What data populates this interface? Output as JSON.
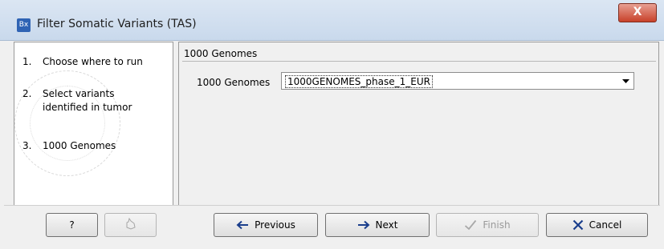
{
  "window": {
    "app_icon_text": "Bx",
    "title": "Filter Somatic Variants (TAS)",
    "close_glyph": "X"
  },
  "steps": [
    {
      "number": "1.",
      "label": "Choose where to run"
    },
    {
      "number": "2.",
      "label": "Select variants identified in tumor"
    },
    {
      "number": "3.",
      "label": "1000 Genomes"
    }
  ],
  "section": {
    "title": "1000 Genomes",
    "field_label": "1000 Genomes",
    "select_value": "1000GENOMES_phase_1_EUR"
  },
  "buttons": {
    "help": "?",
    "previous": "Previous",
    "next": "Next",
    "finish": "Finish",
    "cancel": "Cancel"
  },
  "icons": {
    "previous": "arrow-left-icon",
    "next": "arrow-right-icon",
    "finish": "checkmark-icon",
    "cancel": "x-icon",
    "reset": "reset-icon",
    "select": "chevron-down-icon"
  },
  "colors": {
    "titlebar": "#c9d9ec",
    "close": "#c8412a",
    "cancel_x": "#1a3e8c",
    "arrow": "#1a3e8c"
  }
}
